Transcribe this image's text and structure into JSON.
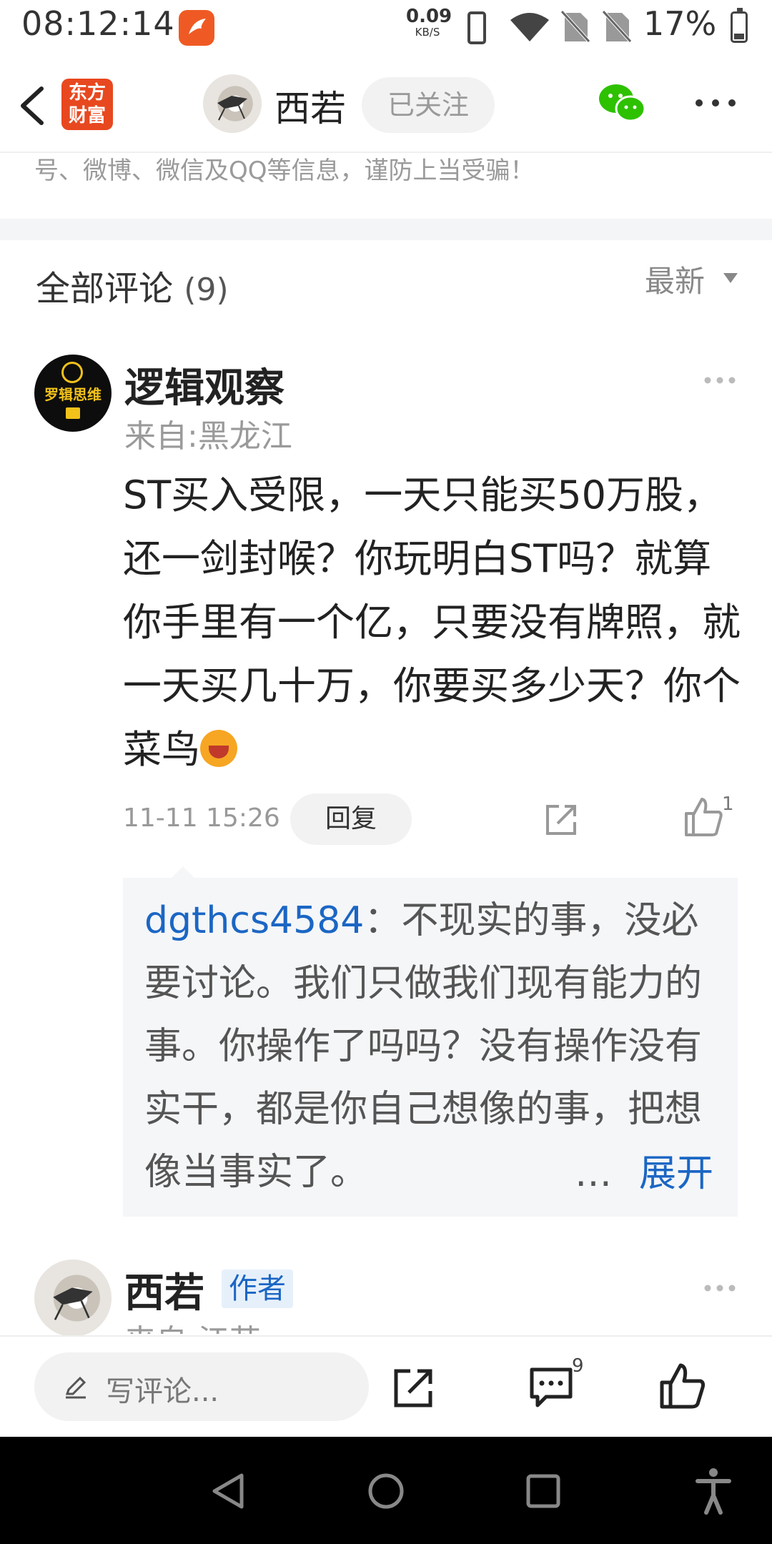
{
  "status_bar": {
    "time": "08:12:14",
    "net_speed_value": "0.09",
    "net_speed_unit": "KB/S",
    "battery_percent": "17%"
  },
  "header": {
    "logo_text_line1": "东方",
    "logo_text_line2": "财富",
    "author_name": "西若",
    "follow_label": "已关注"
  },
  "notice": "号、微博、微信及QQ等信息，谨防上当受骗！",
  "comments_section": {
    "title": "全部评论",
    "count": "(9)",
    "sort_label": "最新"
  },
  "comment1": {
    "avatar_text": "罗辑思维",
    "user": "逻辑观察",
    "location": "来自:黑龙江",
    "text": "ST买入受限，一天只能买50万股，还一剑封喉？你玩明白ST吗？就算你手里有一个亿，只要没有牌照，就一天买几十万，你要买多少天？你个菜鸟",
    "time": "11-11 15:26",
    "reply_label": "回复",
    "like_count": "1"
  },
  "reply": {
    "user": "dgthcs4584",
    "text": "：不现实的事，没必要讨论。我们只做我们现有能力的事。你操作了吗吗？没有操作没有实干，都是你自己想像的事，把想像当事实了。",
    "ellipsis": "…",
    "expand_label": "展开"
  },
  "comment2": {
    "user": "西若",
    "badge": "作者",
    "location": "来自:江苏"
  },
  "bottom_bar": {
    "input_placeholder": "写评论...",
    "comment_count": "9"
  },
  "colors": {
    "link_blue": "#1b66c4",
    "brand_orange": "#e8481f",
    "wechat_green": "#2dc100"
  }
}
